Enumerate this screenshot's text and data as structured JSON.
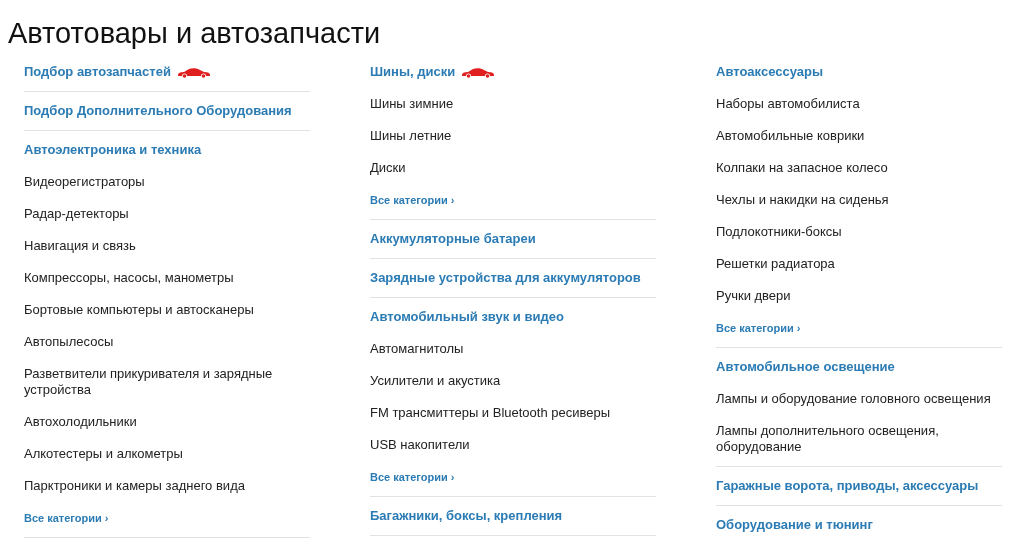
{
  "page_title": "Автотовары и автозапчасти",
  "columns": [
    {
      "sections": [
        {
          "title": "Подбор автозапчастей",
          "car_icon": true
        },
        {
          "title": "Подбор Дополнительного Оборудования",
          "car_icon": false
        },
        {
          "title": "Автоэлектроника и техника",
          "car_icon": false,
          "items": [
            "Видеорегистраторы",
            "Радар-детекторы",
            "Навигация и связь",
            "Компрессоры, насосы, манометры",
            "Бортовые компьютеры и автосканеры",
            "Автопылесосы",
            "Разветвители прикуривателя и зарядные устройства",
            "Автохолодильники",
            "Алкотестеры и алкометры",
            "Парктроники и камеры заднего вида"
          ],
          "more": "Все категории ›"
        }
      ]
    },
    {
      "sections": [
        {
          "title": "Шины, диски",
          "car_icon": true,
          "items": [
            "Шины зимние",
            "Шины летние",
            "Диски"
          ],
          "more": "Все категории ›"
        },
        {
          "title": "Аккумуляторные батареи",
          "car_icon": false
        },
        {
          "title": "Зарядные устройства для аккумуляторов",
          "car_icon": false
        },
        {
          "title": "Автомобильный звук и видео",
          "car_icon": false,
          "items": [
            "Автомагнитолы",
            "Усилители и акустика",
            "FM трансмиттеры и Bluetooth ресиверы",
            "USB накопители"
          ],
          "more": "Все категории ›"
        },
        {
          "title": "Багажники, боксы, крепления",
          "car_icon": false
        }
      ]
    },
    {
      "sections": [
        {
          "title": "Автоаксессуары",
          "car_icon": false,
          "items": [
            "Наборы автомобилиста",
            "Автомобильные коврики",
            "Колпаки на запасное колесо",
            "Чехлы и накидки на сиденья",
            "Подлокотники-боксы",
            "Решетки радиатора",
            "Ручки двери"
          ],
          "more": "Все категории ›"
        },
        {
          "title": "Автомобильное освещение",
          "car_icon": false,
          "items": [
            "Лампы и оборудование головного освещения",
            "Лампы дополнительного освещения, оборудование"
          ]
        },
        {
          "title": "Гаражные ворота, приводы, аксессуары",
          "car_icon": false
        },
        {
          "title": "Оборудование и тюнинг",
          "car_icon": false
        }
      ]
    }
  ]
}
